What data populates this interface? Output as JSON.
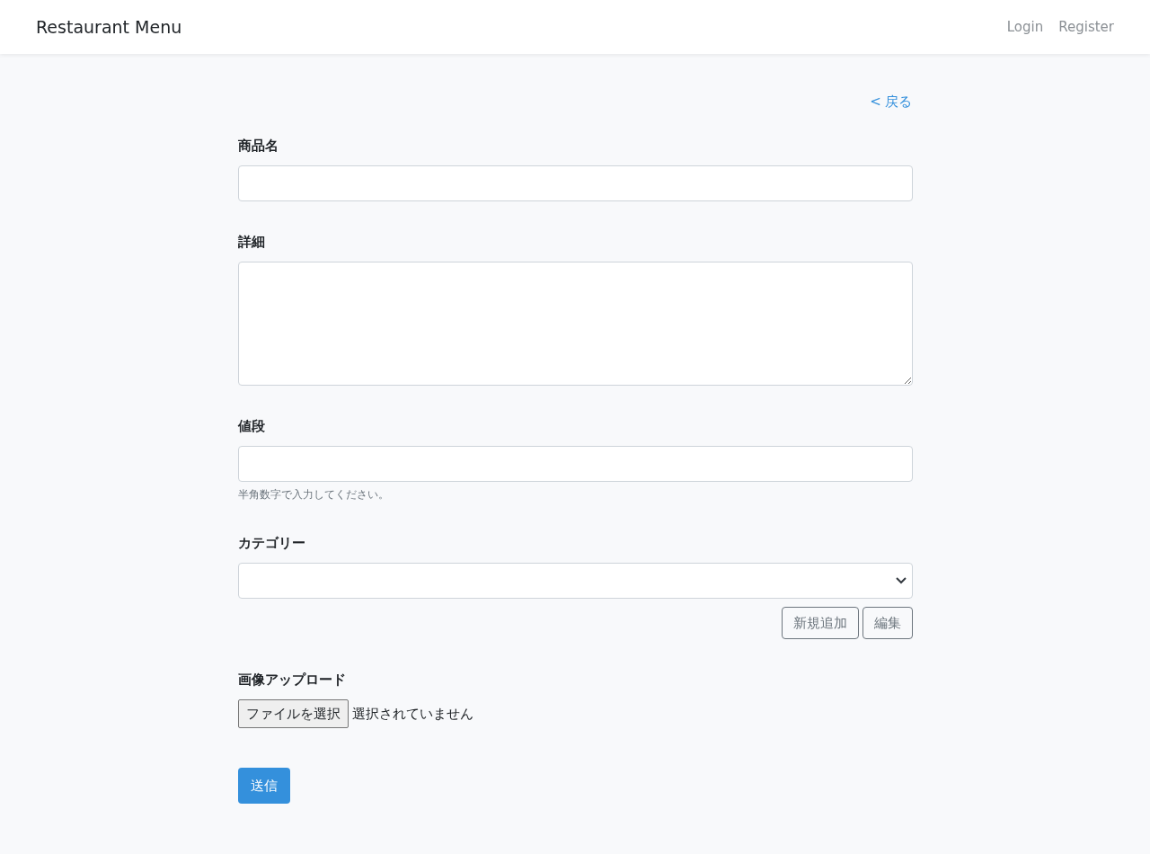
{
  "navbar": {
    "brand": "Restaurant Menu",
    "links": [
      "Login",
      "Register"
    ]
  },
  "back_link": "< 戻る",
  "fields": [
    {
      "kind": "text",
      "label": "商品名"
    },
    {
      "kind": "textarea",
      "label": "詳細"
    },
    {
      "kind": "text",
      "label": "値段",
      "help": "半角数字で入力してください。"
    },
    {
      "kind": "select",
      "label": "カテゴリー",
      "buttons": [
        "新規追加",
        "編集"
      ]
    },
    {
      "kind": "file",
      "label": "画像アップロード",
      "button": "ファイルを選択",
      "status": "選択されていません"
    }
  ],
  "submit": "送信"
}
